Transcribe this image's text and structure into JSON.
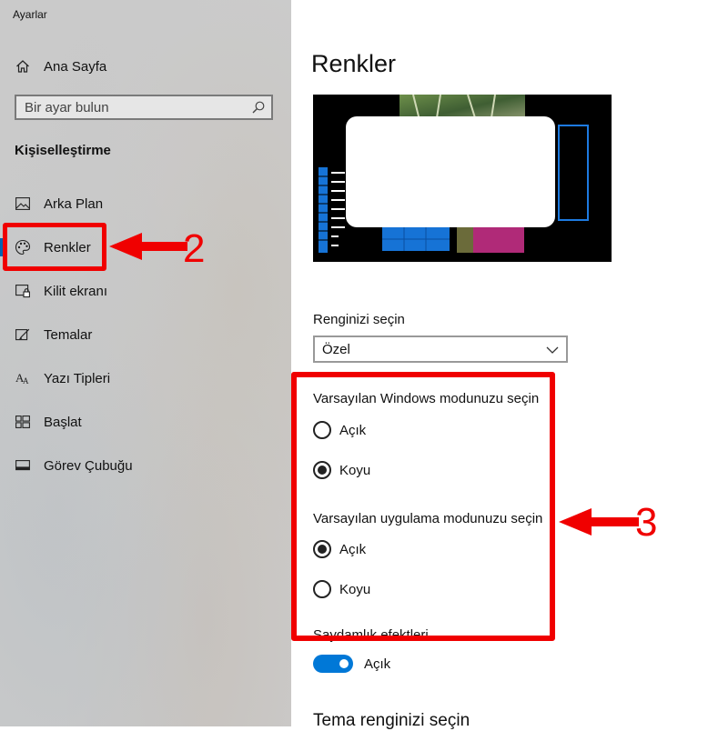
{
  "window": {
    "title": "Ayarlar"
  },
  "sidebar": {
    "home_label": "Ana Sayfa",
    "search_placeholder": "Bir ayar bulun",
    "section_title": "Kişiselleştirme",
    "items": [
      {
        "label": "Arka Plan",
        "icon": "picture-icon"
      },
      {
        "label": "Renkler",
        "icon": "palette-icon",
        "selected": true
      },
      {
        "label": "Kilit ekranı",
        "icon": "lock-screen-icon"
      },
      {
        "label": "Temalar",
        "icon": "themes-icon"
      },
      {
        "label": "Yazı Tipleri",
        "icon": "fonts-icon"
      },
      {
        "label": "Başlat",
        "icon": "start-icon"
      },
      {
        "label": "Görev Çubuğu",
        "icon": "taskbar-icon"
      }
    ]
  },
  "main": {
    "title": "Renkler",
    "color_choice": {
      "label": "Renginizi seçin",
      "selected": "Özel"
    },
    "windows_mode": {
      "label": "Varsayılan Windows modunuzu seçin",
      "options": [
        {
          "label": "Açık",
          "checked": false
        },
        {
          "label": "Koyu",
          "checked": true
        }
      ]
    },
    "app_mode": {
      "label": "Varsayılan uygulama modunuzu seçin",
      "options": [
        {
          "label": "Açık",
          "checked": true
        },
        {
          "label": "Koyu",
          "checked": false
        }
      ]
    },
    "transparency": {
      "label": "Saydamlık efektleri",
      "toggle_label": "Açık",
      "on": true
    },
    "accent_heading": "Tema renginizi seçin"
  },
  "annotations": {
    "arrow_2_label": "2",
    "arrow_3_label": "3",
    "color": "#f00000"
  },
  "colors": {
    "accent": "#0078d7",
    "highlight": "#f00000"
  }
}
